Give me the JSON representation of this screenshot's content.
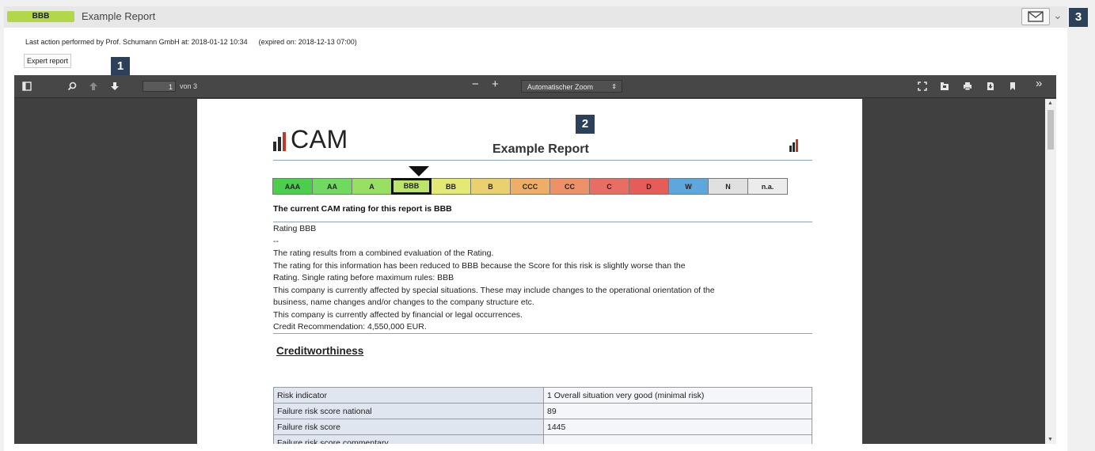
{
  "header": {
    "rating_badge": "BBB",
    "title": "Example Report",
    "accent_color": "#b2d84a"
  },
  "info": {
    "last_action": "Last action performed by Prof. Schumann GmbH at: 2018-01-12 10:34",
    "expired": "(expired on: 2018-12-13 07:00)",
    "expert_button": "Expert report"
  },
  "callouts": [
    "1",
    "2",
    "3"
  ],
  "viewer": {
    "page_current": "1",
    "page_total_label": "von 3",
    "zoom_label": "Automatischer Zoom",
    "icons": [
      "sidebar-toggle-icon",
      "search-icon",
      "previous-page-icon",
      "next-page-icon",
      "zoom-out-icon",
      "zoom-in-icon",
      "presentation-mode-icon",
      "open-file-icon",
      "print-icon",
      "download-icon",
      "bookmark-icon",
      "tools-menu-icon"
    ]
  },
  "document": {
    "logo_text": "CAM",
    "report_title": "Example Report",
    "rating_scale": [
      {
        "label": "AAA",
        "color": "#4bce4b"
      },
      {
        "label": "AA",
        "color": "#6fd960"
      },
      {
        "label": "A",
        "color": "#97e063"
      },
      {
        "label": "BBB",
        "color": "#bde46a"
      },
      {
        "label": "BB",
        "color": "#e3ea73"
      },
      {
        "label": "B",
        "color": "#ebd070"
      },
      {
        "label": "CCC",
        "color": "#eeae68"
      },
      {
        "label": "CC",
        "color": "#ec9168"
      },
      {
        "label": "C",
        "color": "#e86d63"
      },
      {
        "label": "D",
        "color": "#e55c58"
      },
      {
        "label": "W",
        "color": "#5da7de"
      },
      {
        "label": "N",
        "color": "#e0e0e0"
      },
      {
        "label": "n.a.",
        "color": "#ececec"
      }
    ],
    "active_rating": "BBB",
    "current_rating_text": "The current CAM rating for this report is BBB",
    "body_lines": [
      "Rating BBB",
      "--",
      "The rating results from a combined evaluation of the Rating.",
      "The rating for this information has been reduced to BBB because the Score for this risk is slightly worse than the",
      "Rating. Single rating before maximum rules: BBB",
      "This company is currently affected by special situations. These may include changes to the operational orientation of the",
      "business, name changes and/or changes to the company structure etc.",
      "This company is currently affected by financial or legal occurrences.",
      "Credit Recommendation: 4,550,000 EUR."
    ],
    "section_heading": "Creditworthiness",
    "table_rows": [
      {
        "label": "Risk indicator",
        "value": "1   Overall situation very good (minimal risk)"
      },
      {
        "label": "Failure risk score national",
        "value": "89"
      },
      {
        "label": "Failure risk score",
        "value": "1445"
      },
      {
        "label": "Failure risk score commentary",
        "value": ""
      }
    ]
  }
}
